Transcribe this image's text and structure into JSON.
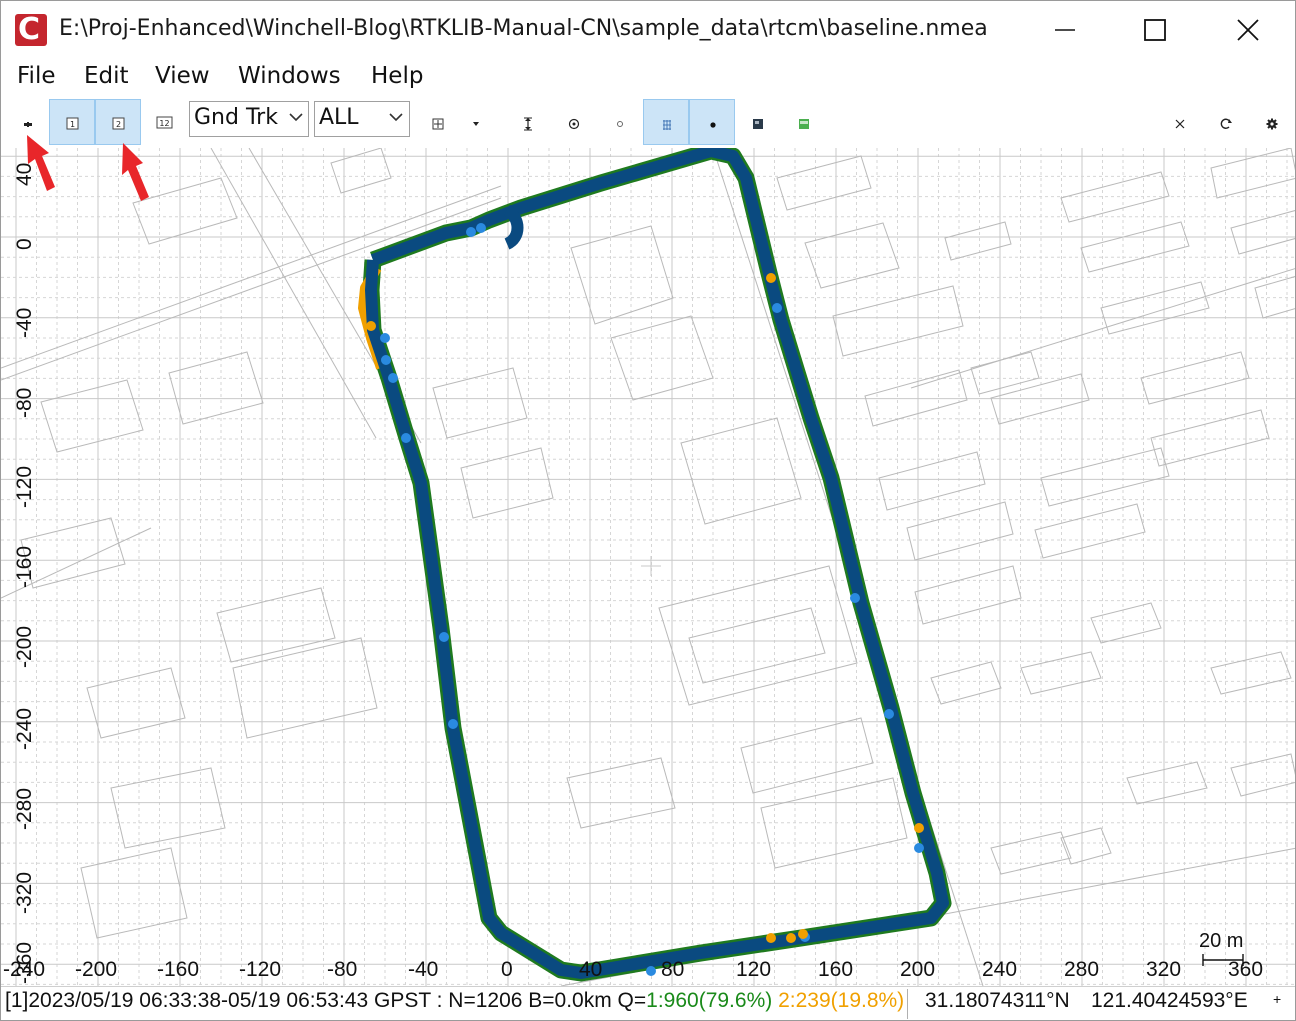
{
  "window": {
    "title": "E:\\Proj-Enhanced\\Winchell-Blog\\RTKLIB-Manual-CN\\sample_data\\rtcm\\baseline.nmea",
    "app_icon_letter": "C"
  },
  "menu": {
    "items": [
      "File",
      "Edit",
      "View",
      "Windows",
      "Help"
    ]
  },
  "toolbar": {
    "plot1_label": "1",
    "plot2_label": "2",
    "plot12_label": "12",
    "plot_type": "Gnd Trk",
    "quality": "ALL",
    "icons": [
      "connect-icon",
      "plot1-icon",
      "plot2-icon",
      "plot12-icon",
      "center-origin-icon",
      "dropdown-icon",
      "fit-vertical-icon",
      "center-icon",
      "show-point-icon",
      "grid-icon",
      "marker-icon",
      "map-image-icon",
      "google-map-icon",
      "clear-icon",
      "reload-icon",
      "options-icon"
    ]
  },
  "plot": {
    "y_ticks": [
      "40",
      "0",
      "-40",
      "-80",
      "-120",
      "-160",
      "-200",
      "-240",
      "-280",
      "-320",
      "-360"
    ],
    "x_ticks": [
      "-240",
      "-200",
      "-160",
      "-120",
      "-80",
      "-40",
      "0",
      "40",
      "80",
      "120",
      "160",
      "200",
      "240",
      "280",
      "320",
      "360"
    ],
    "scale_label": "20 m",
    "colors": {
      "fix": "#1f7a1f",
      "float": "#f0a000",
      "single": "#0a4a80",
      "dgps": "#2a8ae0"
    }
  },
  "status": {
    "summary": "[1]2023/05/19 06:33:38-05/19 06:53:43 GPST : N=1206 B=0.0km Q=",
    "q1": "1:960(79.6%)",
    "q2": "2:239(19.8%)",
    "lat": "31.18074311°N",
    "lon": "121.40424593°E",
    "grip": "+"
  }
}
